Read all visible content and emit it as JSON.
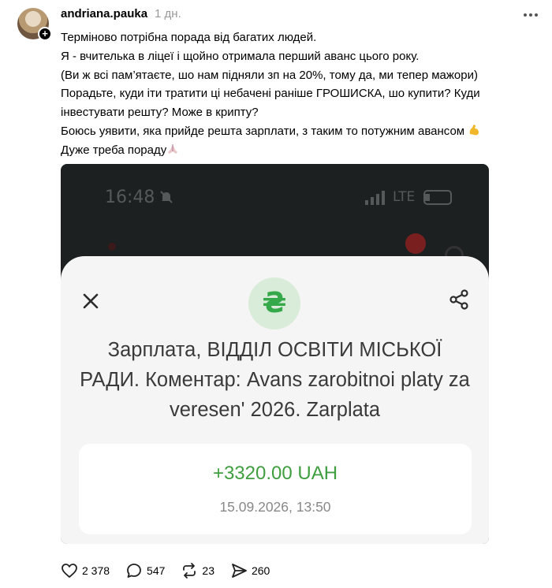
{
  "post": {
    "username": "andriana.pauka",
    "time_ago": "1 дн.",
    "text_lines": [
      "Терміново потрібна порада від багатих людей.",
      "Я - вчителька в ліцеї і щойно отримала перший аванс цього року.",
      "(Ви ж всі пам’ятаєте, шо нам підняли зп на 20%, тому да, ми тепер мажори)",
      "Порадьте, куди іти тратити ці небачені раніше ГРОШИСКА, шо купити? Куди інвестувати решту? Може в крипту?",
      "Боюсь уявити, яка прийде решта зарплати, з таким то потужним авансом",
      "Дуже треба пораду"
    ],
    "emoji_flex": "flexed-biceps-emoji",
    "emoji_pray": "folded-hands-emoji"
  },
  "screenshot": {
    "status_bar": {
      "time": "16:48",
      "network": "LTE"
    },
    "transaction": {
      "title": "Зарплата, ВІДДІЛ ОСВІТИ МІСЬКОЇ РАДИ. Коментар: Avans zarobitnoi platy za veresen' 2026. Zarplata",
      "currency_symbol": "₴",
      "amount": "+3320.00 UAH",
      "datetime": "15.09.2026, 13:50"
    },
    "colors": {
      "amount_green": "#3f9e3f",
      "icon_circle": "#d9ecd9",
      "sheet_bg": "#f5f5f5"
    }
  },
  "actions": {
    "likes": "2 378",
    "comments": "547",
    "reposts": "23",
    "shares": "260"
  }
}
